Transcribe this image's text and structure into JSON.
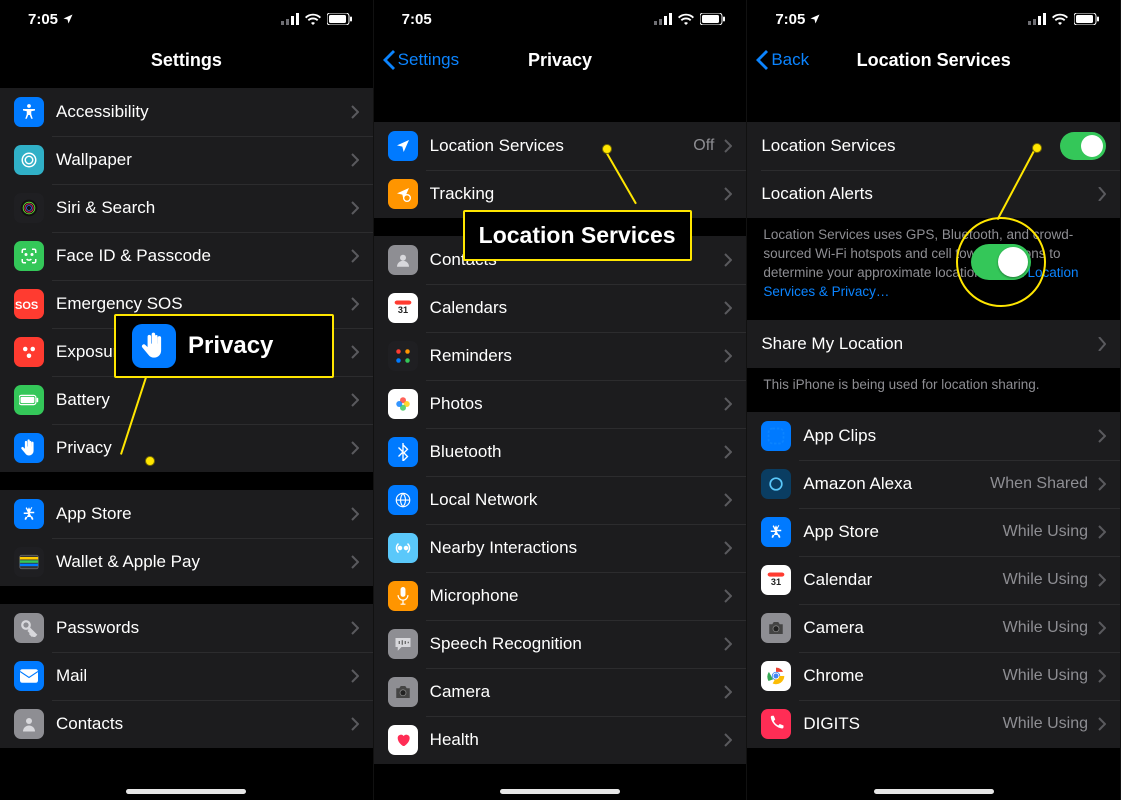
{
  "status": {
    "time": "7:05"
  },
  "screen1": {
    "title": "Settings",
    "items_g1": [
      {
        "label": "Accessibility",
        "icon": "accessibility",
        "bg": "bg-blue"
      },
      {
        "label": "Wallpaper",
        "icon": "wallpaper",
        "bg": "bg-teal"
      },
      {
        "label": "Siri & Search",
        "icon": "siri",
        "bg": "bg-dark"
      },
      {
        "label": "Face ID & Passcode",
        "icon": "faceid",
        "bg": "bg-green"
      },
      {
        "label": "Emergency SOS",
        "icon": "sos",
        "bg": "bg-red"
      },
      {
        "label": "Exposure Notifications",
        "icon": "exposure",
        "bg": "bg-red"
      },
      {
        "label": "Battery",
        "icon": "battery",
        "bg": "bg-green"
      },
      {
        "label": "Privacy",
        "icon": "hand",
        "bg": "bg-blue"
      }
    ],
    "items_g2": [
      {
        "label": "App Store",
        "icon": "appstore",
        "bg": "bg-blue"
      },
      {
        "label": "Wallet & Apple Pay",
        "icon": "wallet",
        "bg": "bg-dark"
      }
    ],
    "items_g3": [
      {
        "label": "Passwords",
        "icon": "key",
        "bg": "bg-gray"
      },
      {
        "label": "Mail",
        "icon": "mail",
        "bg": "bg-blue"
      },
      {
        "label": "Contacts",
        "icon": "contacts",
        "bg": "bg-gray"
      }
    ],
    "callout": {
      "label": "Privacy"
    }
  },
  "screen2": {
    "back": "Settings",
    "title": "Privacy",
    "g1": [
      {
        "label": "Location Services",
        "value": "Off",
        "icon": "location",
        "bg": "bg-blue"
      },
      {
        "label": "Tracking",
        "icon": "tracking",
        "bg": "bg-orange"
      }
    ],
    "g2": [
      {
        "label": "Contacts",
        "icon": "contacts2",
        "bg": "bg-gray"
      },
      {
        "label": "Calendars",
        "icon": "calendar",
        "bg": "bg-redcal"
      },
      {
        "label": "Reminders",
        "icon": "reminders",
        "bg": "bg-dark"
      },
      {
        "label": "Photos",
        "icon": "photos",
        "bg": "bg-redcal"
      },
      {
        "label": "Bluetooth",
        "icon": "bluetooth",
        "bg": "bg-blue"
      },
      {
        "label": "Local Network",
        "icon": "network",
        "bg": "bg-blue"
      },
      {
        "label": "Nearby Interactions",
        "icon": "nearby",
        "bg": "bg-sky"
      },
      {
        "label": "Microphone",
        "icon": "mic",
        "bg": "bg-orange"
      },
      {
        "label": "Speech Recognition",
        "icon": "speech",
        "bg": "bg-gray"
      },
      {
        "label": "Camera",
        "icon": "camera",
        "bg": "bg-gray"
      },
      {
        "label": "Health",
        "icon": "health",
        "bg": "bg-white"
      }
    ],
    "callout": {
      "label": "Location Services"
    }
  },
  "screen3": {
    "back": "Back",
    "title": "Location Services",
    "row1": {
      "label": "Location Services"
    },
    "row2": {
      "label": "Location Alerts"
    },
    "footer1": "Location Services uses GPS, Bluetooth, and crowd-sourced Wi-Fi hotspots and cell tower locations to determine your approximate location. ",
    "footer1_link": "About Location Services & Privacy…",
    "row3": {
      "label": "Share My Location"
    },
    "footer2": "This iPhone is being used for location sharing.",
    "apps": [
      {
        "label": "App Clips",
        "value": "",
        "bg": "bg-blue",
        "icon": "appclips"
      },
      {
        "label": "Amazon Alexa",
        "value": "When Shared",
        "bg": "bg-navy",
        "icon": "alexa"
      },
      {
        "label": "App Store",
        "value": "While Using",
        "bg": "bg-blue",
        "icon": "appstore"
      },
      {
        "label": "Calendar",
        "value": "While Using",
        "bg": "bg-redcal",
        "icon": "calendar"
      },
      {
        "label": "Camera",
        "value": "While Using",
        "bg": "bg-gray",
        "icon": "camera"
      },
      {
        "label": "Chrome",
        "value": "While Using",
        "bg": "bg-white",
        "icon": "chrome"
      },
      {
        "label": "DIGITS",
        "value": "While Using",
        "bg": "bg-pink",
        "icon": "digits"
      }
    ]
  }
}
